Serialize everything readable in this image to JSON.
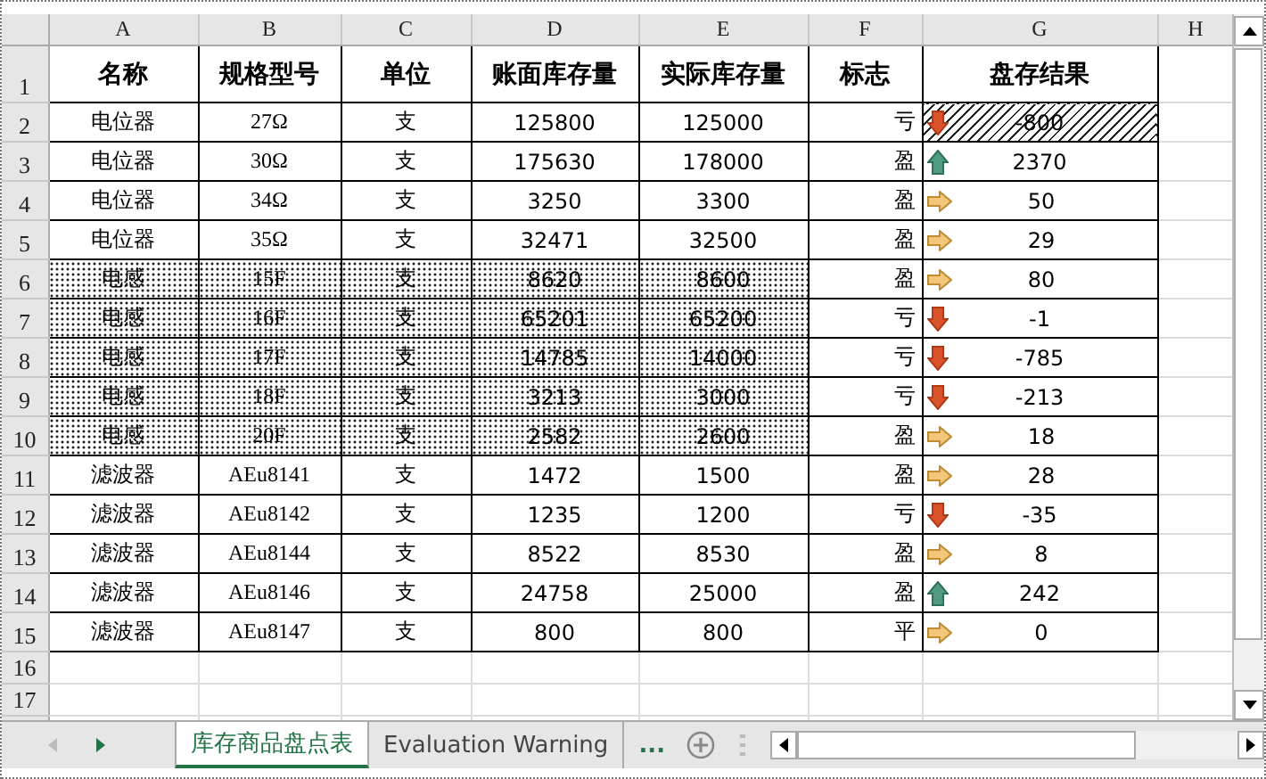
{
  "columns": [
    "A",
    "B",
    "C",
    "D",
    "E",
    "F",
    "G",
    "H"
  ],
  "header": {
    "row": "1",
    "cells": [
      "名称",
      "规格型号",
      "单位",
      "账面库存量",
      "实际库存量",
      "标志",
      "盘存结果"
    ]
  },
  "rows": [
    {
      "row": "2",
      "name": "电位器",
      "spec": "27Ω",
      "unit": "支",
      "book": "125800",
      "actual": "125000",
      "flag": "亏",
      "kind": "down",
      "result": "-800",
      "shaded": false,
      "result_hatched": true
    },
    {
      "row": "3",
      "name": "电位器",
      "spec": "30Ω",
      "unit": "支",
      "book": "175630",
      "actual": "178000",
      "flag": "盈",
      "kind": "up",
      "result": "2370",
      "shaded": false,
      "result_hatched": false
    },
    {
      "row": "4",
      "name": "电位器",
      "spec": "34Ω",
      "unit": "支",
      "book": "3250",
      "actual": "3300",
      "flag": "盈",
      "kind": "right",
      "result": "50",
      "shaded": false,
      "result_hatched": false
    },
    {
      "row": "5",
      "name": "电位器",
      "spec": "35Ω",
      "unit": "支",
      "book": "32471",
      "actual": "32500",
      "flag": "盈",
      "kind": "right",
      "result": "29",
      "shaded": false,
      "result_hatched": false
    },
    {
      "row": "6",
      "name": "电感",
      "spec": "15F",
      "unit": "支",
      "book": "8620",
      "actual": "8600",
      "flag": "盈",
      "kind": "right",
      "result": "80",
      "shaded": true,
      "result_hatched": false
    },
    {
      "row": "7",
      "name": "电感",
      "spec": "16F",
      "unit": "支",
      "book": "65201",
      "actual": "65200",
      "flag": "亏",
      "kind": "down",
      "result": "-1",
      "shaded": true,
      "result_hatched": false
    },
    {
      "row": "8",
      "name": "电感",
      "spec": "17F",
      "unit": "支",
      "book": "14785",
      "actual": "14000",
      "flag": "亏",
      "kind": "down",
      "result": "-785",
      "shaded": true,
      "result_hatched": false
    },
    {
      "row": "9",
      "name": "电感",
      "spec": "18F",
      "unit": "支",
      "book": "3213",
      "actual": "3000",
      "flag": "亏",
      "kind": "down",
      "result": "-213",
      "shaded": true,
      "result_hatched": false
    },
    {
      "row": "10",
      "name": "电感",
      "spec": "20F",
      "unit": "支",
      "book": "2582",
      "actual": "2600",
      "flag": "盈",
      "kind": "right",
      "result": "18",
      "shaded": true,
      "result_hatched": false
    },
    {
      "row": "11",
      "name": "滤波器",
      "spec": "AEu8141",
      "unit": "支",
      "book": "1472",
      "actual": "1500",
      "flag": "盈",
      "kind": "right",
      "result": "28",
      "shaded": false,
      "result_hatched": false
    },
    {
      "row": "12",
      "name": "滤波器",
      "spec": "AEu8142",
      "unit": "支",
      "book": "1235",
      "actual": "1200",
      "flag": "亏",
      "kind": "down",
      "result": "-35",
      "shaded": false,
      "result_hatched": false
    },
    {
      "row": "13",
      "name": "滤波器",
      "spec": "AEu8144",
      "unit": "支",
      "book": "8522",
      "actual": "8530",
      "flag": "盈",
      "kind": "right",
      "result": "8",
      "shaded": false,
      "result_hatched": false
    },
    {
      "row": "14",
      "name": "滤波器",
      "spec": "AEu8146",
      "unit": "支",
      "book": "24758",
      "actual": "25000",
      "flag": "盈",
      "kind": "up",
      "result": "242",
      "shaded": false,
      "result_hatched": false
    },
    {
      "row": "15",
      "name": "滤波器",
      "spec": "AEu8147",
      "unit": "支",
      "book": "800",
      "actual": "800",
      "flag": "平",
      "kind": "right",
      "result": "0",
      "shaded": false,
      "result_hatched": false
    }
  ],
  "empty_rows": [
    "16",
    "17"
  ],
  "sheet_tabs": [
    {
      "label": "库存商品盘点表",
      "selected": true
    },
    {
      "label": "Evaluation Warning",
      "selected": false
    }
  ],
  "more_tabs": "..."
}
